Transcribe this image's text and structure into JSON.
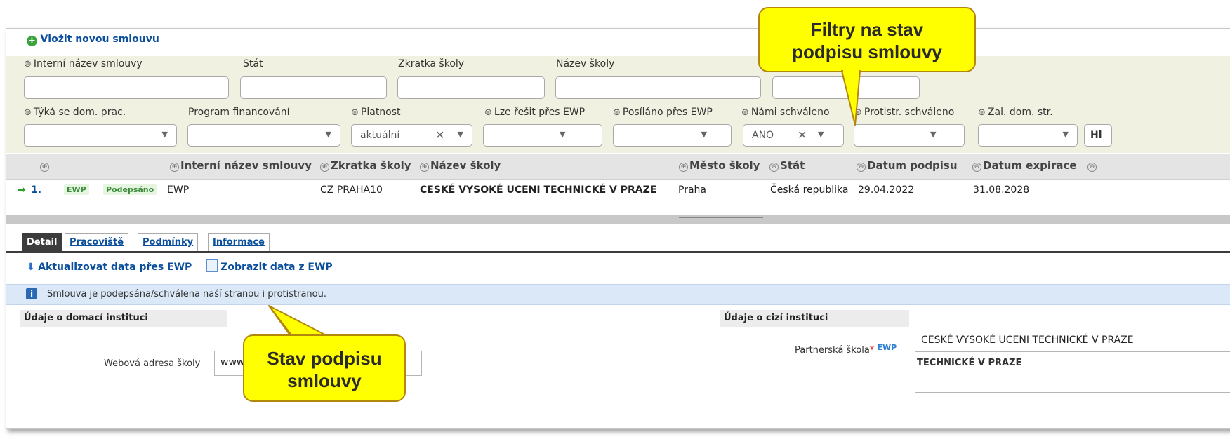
{
  "new_contract_link": "Vložit novou smlouvu",
  "filters": {
    "row1": {
      "internal_name": "Interní název smlouvy",
      "country": "Stát",
      "school_abbr": "Zkratka školy",
      "school_name": "Název školy"
    },
    "row2": {
      "home_work": "Týká se dom. prac.",
      "funding": "Program financování",
      "validity": "Platnost",
      "validity_value": "aktuální",
      "ewp_solvable": "Lze řešit přes EWP",
      "sent_ewp": "Posíláno přes EWP",
      "approved_us": "Námi schváleno",
      "approved_us_value": "ANO",
      "approved_partner": "Protistr. schváleno",
      "home_page": "Zal. dom. str.",
      "search_btn": "Hl"
    }
  },
  "grid": {
    "headers": {
      "internal_name": "Interní název smlouvy",
      "school_abbr": "Zkratka školy",
      "school_name": "Název školy",
      "city": "Město školy",
      "country": "Stát",
      "signed_date": "Datum podpisu",
      "expire_date": "Datum expirace"
    },
    "rows": [
      {
        "num": "1.",
        "tag_ewp": "EWP",
        "tag_status": "Podepsáno",
        "internal_name": "EWP",
        "school_abbr": "CZ PRAHA10",
        "school_name": "CESKÉ VYSOKÉ UCENI TECHNICKÉ V PRAZE",
        "city": "Praha",
        "country": "Česká republika",
        "signed_date": "29.04.2022",
        "expire_date": "31.08.2028"
      }
    ]
  },
  "tabs": [
    "Detail",
    "Pracoviště",
    "Podmínky",
    "Informace"
  ],
  "actions": {
    "update_ewp": "Aktualizovat data přes EWP",
    "show_ewp": "Zobrazit data z EWP"
  },
  "info_message": "Smlouva je podepsána/schválena naší stranou i protistranou.",
  "sections": {
    "home": "Údaje o domací instituci",
    "foreign": "Údaje o cizí instituci"
  },
  "form": {
    "web_label": "Webová adresa školy",
    "web_value": "www",
    "partner_label": "Partnerská škola",
    "partner_ewp": "EWP",
    "partner_value": "CESKÉ VYSOKÉ UCENI TECHNICKÉ V PRAZE",
    "partner_value_line2": "TECHNICKÉ V PRAZE"
  },
  "callouts": {
    "filters": [
      "Filtry na stav",
      "podpisu smlouvy"
    ],
    "status": [
      "Stav podpisu",
      "smlouvy"
    ]
  },
  "colors": {
    "callout_fill": "#ffff00",
    "link": "#0b4f9c",
    "tab_active": "#3c3c3c",
    "info_bg": "#dbe8f7"
  }
}
